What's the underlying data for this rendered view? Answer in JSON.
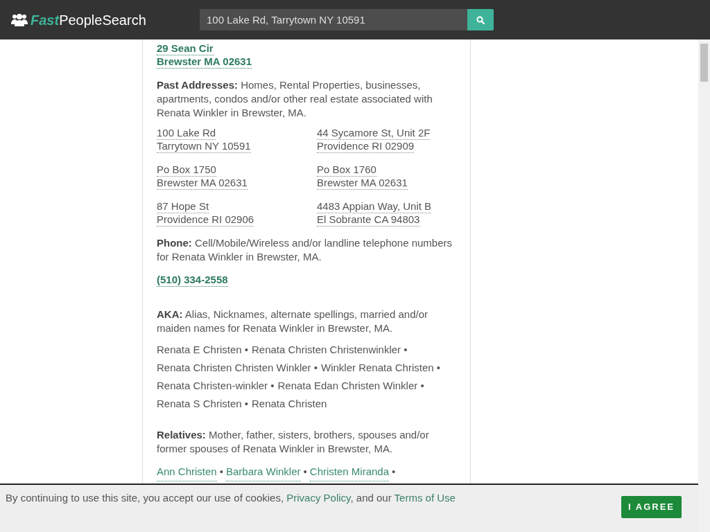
{
  "header": {
    "logo_prefix": "Fast",
    "logo_suffix": "PeopleSearch",
    "search": {
      "value": "100 Lake Rd, Tarrytown NY 10591"
    }
  },
  "current_address": [
    "29 Sean Cir",
    "Brewster MA 02631"
  ],
  "past_addresses": {
    "label": "Past Addresses:",
    "description": "Homes, Rental Properties, businesses, apartments, condos and/or other real estate associated with Renata Winkler in Brewster, MA.",
    "items": [
      [
        "100 Lake Rd",
        "Tarrytown NY 10591"
      ],
      [
        "44 Sycamore St, Unit 2F",
        "Providence RI 02909"
      ],
      [
        "Po Box 1750",
        "Brewster MA 02631"
      ],
      [
        "Po Box 1760",
        "Brewster MA 02631"
      ],
      [
        "87 Hope St",
        "Providence RI 02906"
      ],
      [
        "4483 Appian Way, Unit B",
        "El Sobrante CA 94803"
      ]
    ]
  },
  "phone": {
    "label": "Phone:",
    "description": "Cell/Mobile/Wireless and/or landline telephone numbers for Renata Winkler in Brewster, MA.",
    "numbers": [
      "(510) 334-2558"
    ]
  },
  "aka": {
    "label": "AKA:",
    "description": "Alias, Nicknames, alternate spellings, married and/or maiden names for Renata Winkler in Brewster, MA.",
    "separator": "•",
    "names": [
      "Renata E Christen",
      "Renata Christen Christenwinkler",
      "Renata Christen Christen Winkler",
      "Winkler Renata Christen",
      "Renata Christen-winkler",
      "Renata Edan Christen Winkler",
      "Renata S Christen",
      "Renata Christen"
    ]
  },
  "relatives": {
    "label": "Relatives:",
    "description": "Mother, father, sisters, brothers, spouses and/or former spouses of Renata Winkler in Brewster, MA.",
    "separator": "•",
    "names": [
      "Ann Christen",
      "Barbara Winkler",
      "Christen Miranda"
    ]
  },
  "cookie_banner": {
    "text_before": "By continuing to use this site, you accept our use of cookies,",
    "link_1": "Privacy Policy",
    "text_middle": ", and our",
    "link_2": "Terms of Use",
    "button": "I AGREE"
  }
}
